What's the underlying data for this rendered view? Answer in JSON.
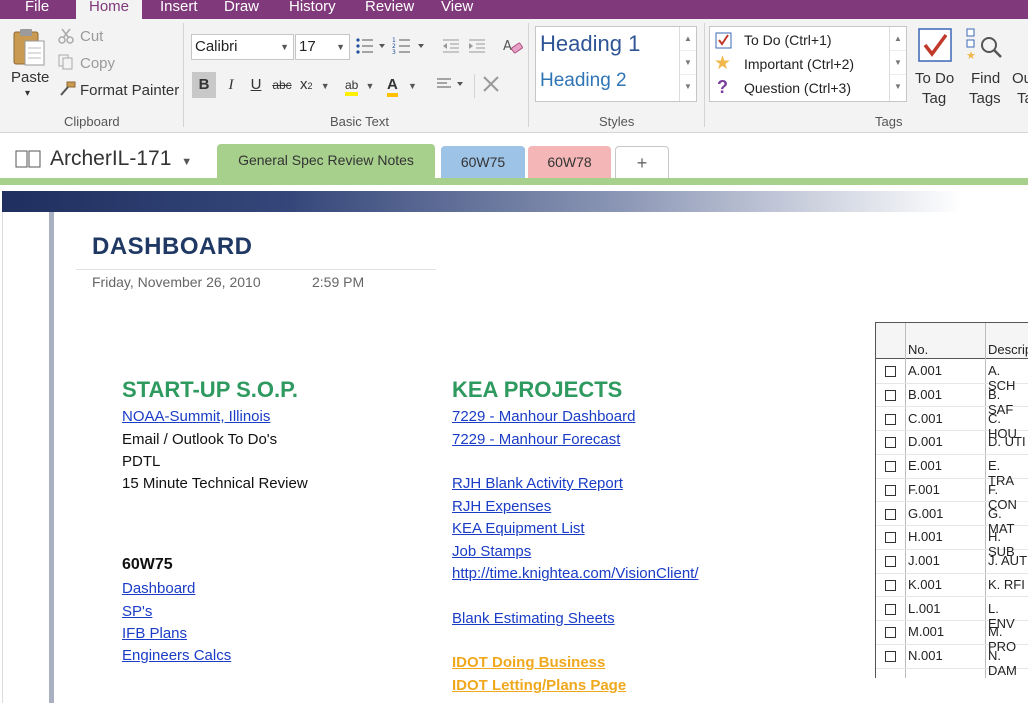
{
  "menu": {
    "tabs": [
      "File",
      "Home",
      "Insert",
      "Draw",
      "History",
      "Review",
      "View"
    ]
  },
  "ribbon": {
    "clipboard": {
      "paste": "Paste",
      "cut": "Cut",
      "copy": "Copy",
      "format_painter": "Format Painter",
      "label": "Clipboard"
    },
    "basic_text": {
      "font": "Calibri",
      "size": "17",
      "label": "Basic Text",
      "bold": "B",
      "italic": "I",
      "underline": "U",
      "strike": "abc",
      "subscript": "x",
      "subscript_suffix": "2",
      "highlight": "ab",
      "font_color": "A"
    },
    "styles": {
      "heading1": "Heading 1",
      "heading2": "Heading 2",
      "label": "Styles"
    },
    "tags": {
      "todo": "To Do (Ctrl+1)",
      "important": "Important (Ctrl+2)",
      "question": "Question (Ctrl+3)",
      "label": "Tags",
      "todo_tag_line1": "To Do",
      "todo_tag_line2": "Tag",
      "find_tags_line1": "Find",
      "find_tags_line2": "Tags",
      "outlook_line1": "Ou",
      "outlook_line2": "Ta"
    }
  },
  "notebook": {
    "name": "ArcherIL-171",
    "sections": [
      {
        "label": "General Spec Review Notes",
        "color": "#a8d08d"
      },
      {
        "label": "60W75",
        "color": "#9dc3e6"
      },
      {
        "label": "60W78",
        "color": "#f4b6b6"
      }
    ],
    "add_label": "+"
  },
  "page": {
    "title": "DASHBOARD",
    "date": "Friday, November 26, 2010",
    "time": "2:59 PM",
    "startup": {
      "heading": "START-UP S.O.P.",
      "items": [
        {
          "text": "NOAA-Summit, Illinois",
          "link": true
        },
        {
          "text": "Email / Outlook To Do's",
          "link": false
        },
        {
          "text": "PDTL",
          "link": false
        },
        {
          "text": "15 Minute Technical Review",
          "link": false
        }
      ]
    },
    "w75": {
      "heading": "60W75",
      "items": [
        "Dashboard",
        "SP's",
        "IFB Plans",
        "Engineers Calcs"
      ]
    },
    "kea": {
      "heading": "KEA PROJECTS",
      "items": [
        "7229 - Manhour Dashboard",
        "7229 - Manhour Forecast",
        "RJH Blank Activity Report",
        "RJH Expenses",
        "KEA Equipment List",
        "Job Stamps",
        "http://time.knightea.com/VisionClient/",
        "Blank Estimating Sheets"
      ],
      "orange_items": [
        "IDOT Doing Business",
        "IDOT Letting/Plans Page"
      ]
    },
    "table": {
      "headers": [
        "No.",
        "Descrip"
      ],
      "rows": [
        {
          "no": "A.001",
          "desc": "A. SCH"
        },
        {
          "no": "B.001",
          "desc": "B. SAF"
        },
        {
          "no": "C.001",
          "desc": "C. HOU"
        },
        {
          "no": "D.001",
          "desc": "D. UTI"
        },
        {
          "no": "E.001",
          "desc": "E. TRA"
        },
        {
          "no": "F.001",
          "desc": "F. CON"
        },
        {
          "no": "G.001",
          "desc": "G. MAT"
        },
        {
          "no": "H.001",
          "desc": "H. SUB"
        },
        {
          "no": "J.001",
          "desc": "J. AUT"
        },
        {
          "no": "K.001",
          "desc": "K. RFI"
        },
        {
          "no": "L.001",
          "desc": "L. ENV"
        },
        {
          "no": "M.001",
          "desc": "M. PRO"
        },
        {
          "no": "N.001",
          "desc": "N. DAM"
        }
      ]
    }
  },
  "colors": {
    "brand": "#80397b",
    "heading_green": "#2e9a5f",
    "title_navy": "#1f3864",
    "link_blue": "#1a3cc6",
    "orange_link": "#f0a81e"
  }
}
